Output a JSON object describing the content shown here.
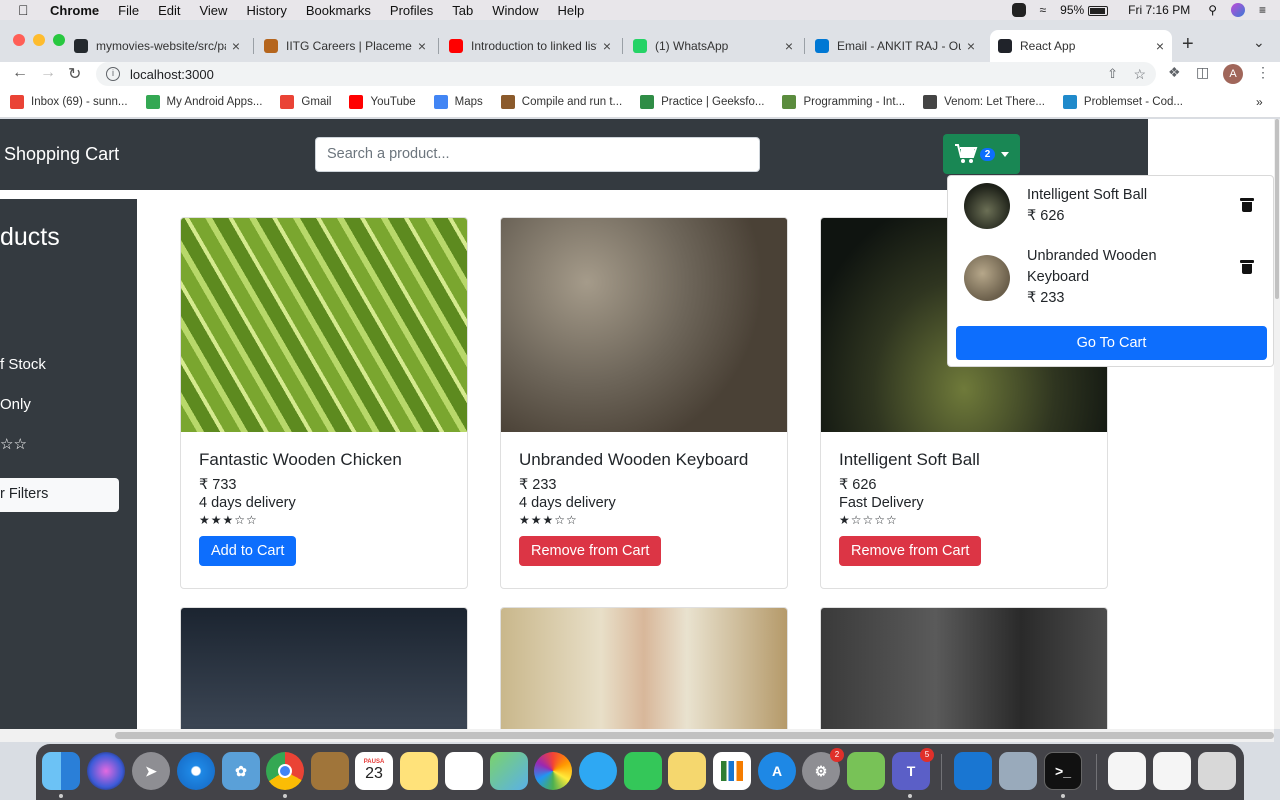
{
  "menubar": {
    "app": "Chrome",
    "items": [
      "File",
      "Edit",
      "View",
      "History",
      "Bookmarks",
      "Profiles",
      "Tab",
      "Window",
      "Help"
    ],
    "battery": "95%",
    "clock": "Fri 7:16 PM"
  },
  "tabs": [
    {
      "title": "mymovies-website/src/pa",
      "icon": "github-icon",
      "color": "#24292e"
    },
    {
      "title": "IITG Careers | Placement",
      "icon": "iitg-icon",
      "color": "#b5651d"
    },
    {
      "title": "Introduction to linked list",
      "icon": "youtube-icon",
      "color": "#ff0000"
    },
    {
      "title": "(1) WhatsApp",
      "icon": "whatsapp-icon",
      "color": "#25d366"
    },
    {
      "title": "Email - ANKIT RAJ - Outl",
      "icon": "outlook-icon",
      "color": "#0078d4"
    },
    {
      "title": "React App",
      "icon": "react-icon",
      "color": "#20232a"
    }
  ],
  "toolbar": {
    "url": "localhost:3000",
    "profile_initial": "A"
  },
  "bookmarks": [
    {
      "label": "Inbox (69) - sunn...",
      "color": "#ea4335"
    },
    {
      "label": "My Android Apps...",
      "color": "#34a853"
    },
    {
      "label": "Gmail",
      "color": "#ea4335"
    },
    {
      "label": "YouTube",
      "color": "#ff0000"
    },
    {
      "label": "Maps",
      "color": "#4285f4"
    },
    {
      "label": "Compile and run t...",
      "color": "#8b5a2b"
    },
    {
      "label": "Practice | Geeksfo...",
      "color": "#2f8d46"
    },
    {
      "label": "Programming - Int...",
      "color": "#5b8c3e"
    },
    {
      "label": "Venom: Let There...",
      "color": "#444444"
    },
    {
      "label": "Problemset - Cod...",
      "color": "#1f8acb"
    }
  ],
  "app": {
    "brand": "Shopping Cart",
    "search_placeholder": "Search a product...",
    "cart_count": "2",
    "sidebar": {
      "title": "ducts",
      "options": [
        "f Stock",
        "Only"
      ],
      "rating": "☆☆",
      "clear_label": "r Filters"
    },
    "products": [
      {
        "name": "Fantastic Wooden Chicken",
        "price": "₹ 733",
        "delivery": "4 days delivery",
        "rating": "★★★☆☆",
        "button": "Add to Cart",
        "btn_type": "add"
      },
      {
        "name": "Unbranded Wooden Keyboard",
        "price": "₹ 233",
        "delivery": "4 days delivery",
        "rating": "★★★☆☆",
        "button": "Remove from Cart",
        "btn_type": "rem"
      },
      {
        "name": "Intelligent Soft Ball",
        "price": "₹ 626",
        "delivery": "Fast Delivery",
        "rating": "★☆☆☆☆",
        "button": "Remove from Cart",
        "btn_type": "rem"
      }
    ],
    "cart_items": [
      {
        "name": "Intelligent Soft Ball",
        "price": "₹ 626"
      },
      {
        "name": "Unbranded Wooden Keyboard",
        "price": "₹ 233"
      }
    ],
    "go_to_cart": "Go To Cart"
  },
  "dock": {
    "calendar_month": "PAUSA",
    "calendar_day": "23",
    "settings_badge": "2",
    "teams_badge": "5"
  }
}
